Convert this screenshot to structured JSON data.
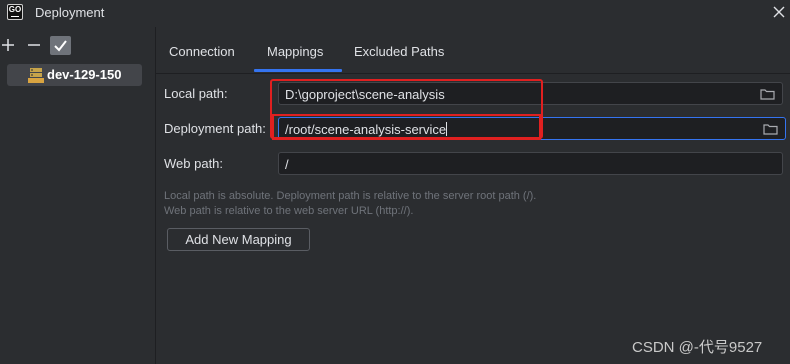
{
  "window": {
    "title": "Deployment",
    "app_icon_text": "GO"
  },
  "toolbar": {
    "add_icon": "plus-icon",
    "remove_icon": "minus-icon",
    "check_icon": "checkmark-icon"
  },
  "servers": [
    {
      "label": "dev-129-150",
      "icon": "sftp-server-icon"
    }
  ],
  "tabs": [
    {
      "label": "Connection"
    },
    {
      "label": "Mappings",
      "selected": true
    },
    {
      "label": "Excluded Paths"
    }
  ],
  "mappings": {
    "local_path_label": "Local path:",
    "local_path_value": "D:\\goproject\\scene-analysis",
    "deployment_path_label": "Deployment path:",
    "deployment_path_value": "/root/scene-analysis-service",
    "web_path_label": "Web path:",
    "web_path_value": "/",
    "hint_line1": "Local path is absolute. Deployment path is relative to the server root path (/).",
    "hint_line2": "Web path is relative to the web server URL (http://).",
    "add_mapping_label": "Add New Mapping"
  },
  "watermark": "CSDN @-代号9527",
  "colors": {
    "background": "#2b2d30",
    "input_bg": "#1e1f22",
    "accent": "#3574f0",
    "annotation_red": "#e02020",
    "selected_item": "#43454a"
  }
}
